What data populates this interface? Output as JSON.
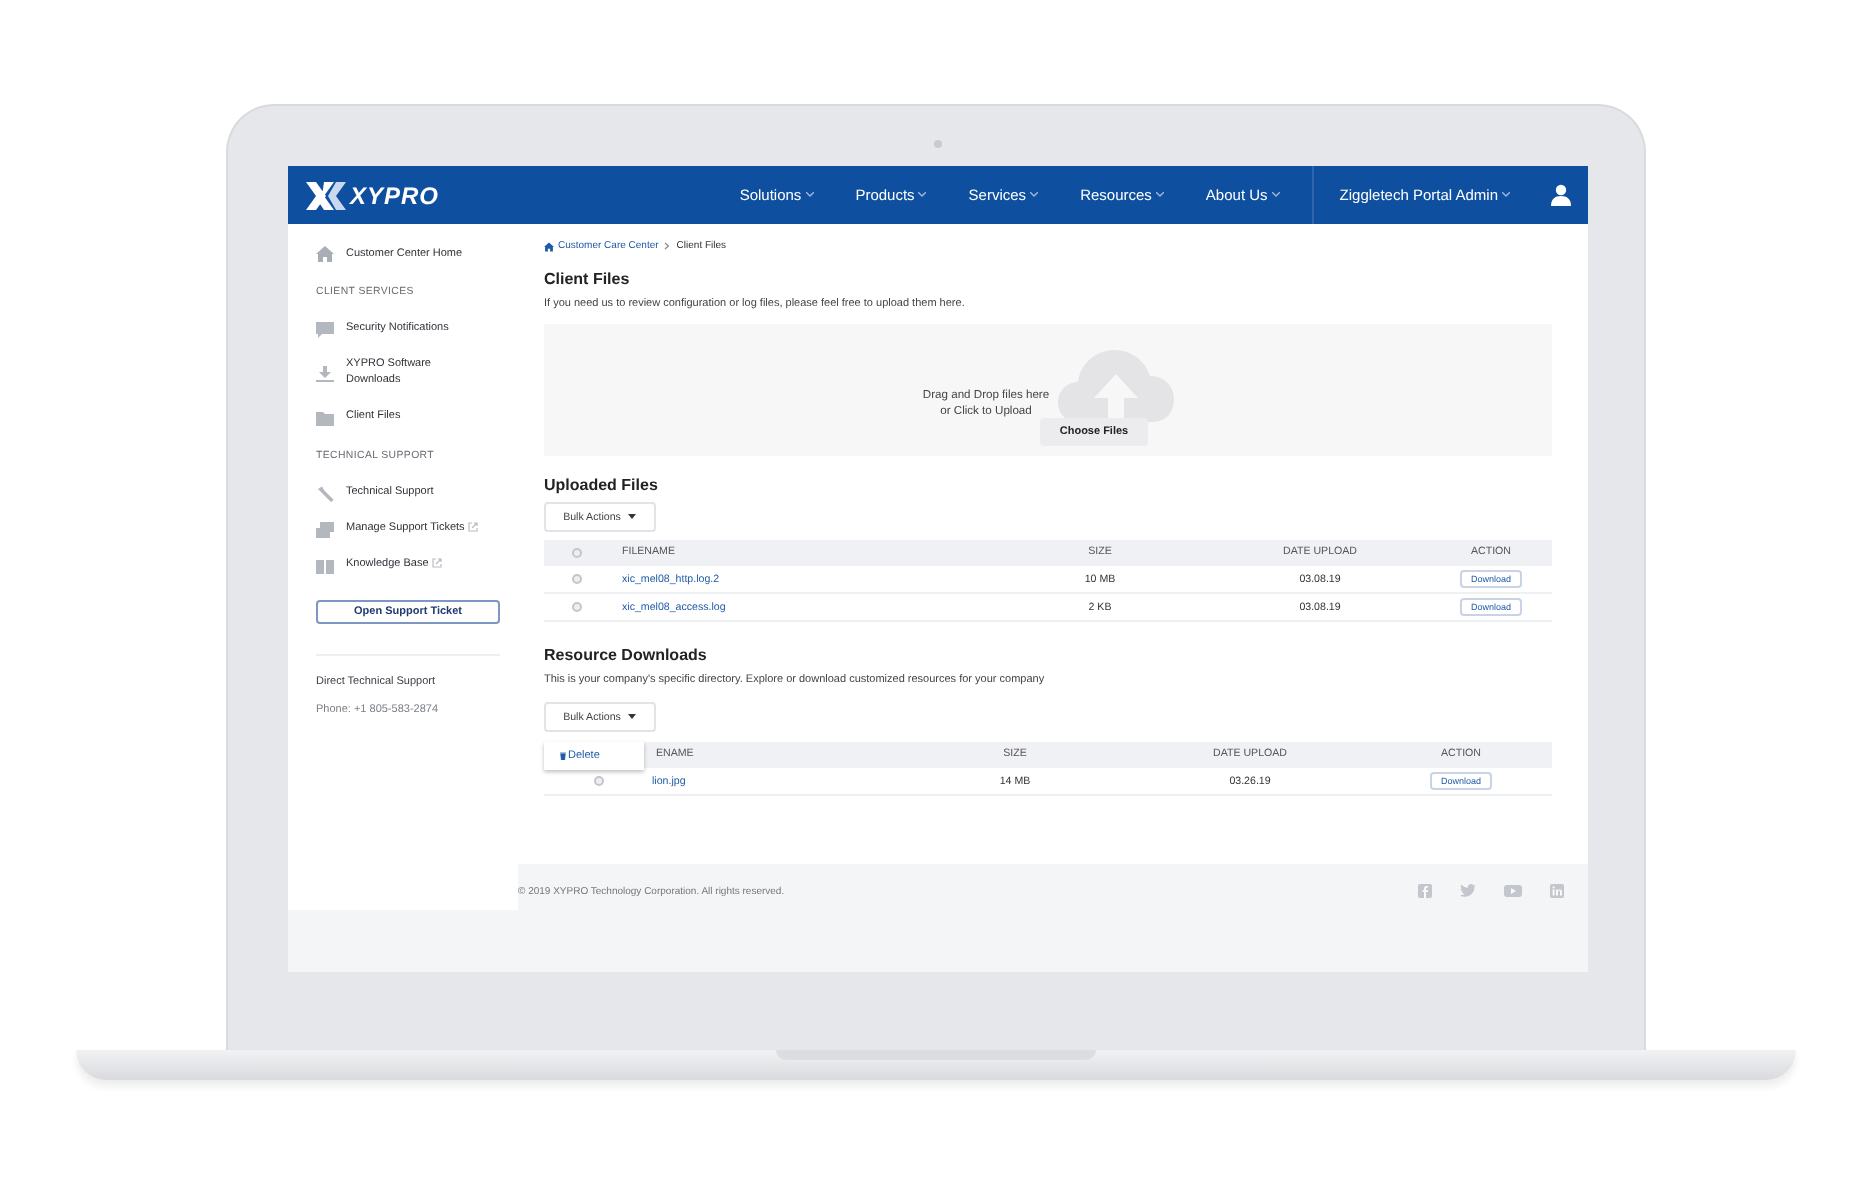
{
  "nav": {
    "logo": "XYPRO",
    "items": [
      {
        "label": "Solutions"
      },
      {
        "label": "Products"
      },
      {
        "label": "Services"
      },
      {
        "label": "Resources"
      },
      {
        "label": "About Us"
      }
    ],
    "account": "Ziggletech Portal Admin"
  },
  "sidebar": {
    "home": "Customer Center Home",
    "sections": [
      {
        "heading": "CLIENT SERVICES",
        "items": [
          {
            "label": "Security Notifications",
            "external": false
          },
          {
            "label": "XYPRO Software Downloads",
            "external": false
          },
          {
            "label": "Client Files",
            "external": false
          }
        ]
      },
      {
        "heading": "TECHNICAL SUPPORT",
        "items": [
          {
            "label": "Technical Support",
            "external": false
          },
          {
            "label": "Manage Support Tickets",
            "external": true
          },
          {
            "label": "Knowledge Base",
            "external": true
          }
        ]
      }
    ],
    "button": "Open Support Ticket",
    "contact_title": "Direct Technical Support",
    "phone": "Phone: +1 805-583-2874"
  },
  "breadcrumb": [
    "Customer Care Center",
    "Client Files"
  ],
  "client_files": {
    "title": "Client Files",
    "description": "If you need us to review configuration or log files, please feel free to upload them here.",
    "drop_lines": [
      "Drag and Drop files here",
      "or Click to Upload"
    ],
    "choose_button": "Choose Files"
  },
  "uploaded": {
    "title": "Uploaded Files",
    "bulk_button": "Bulk Actions",
    "all_checked": false,
    "columns": [
      "FILENAME",
      "SIZE",
      "DATE UPLOAD",
      "ACTION"
    ],
    "rows": [
      {
        "checked": false,
        "filename": "xic_mel08_http.log.2",
        "size": "10 MB",
        "date": "03.08.19",
        "action": "Download"
      },
      {
        "checked": false,
        "filename": "xic_mel08_access.log",
        "size": "2 KB",
        "date": "03.08.19",
        "action": "Download"
      }
    ]
  },
  "resources": {
    "title": "Resource Downloads",
    "description": "This is your company's specific directory. Explore or download customized resources for your company",
    "bulk_button": "Bulk Actions",
    "menu": {
      "open": true,
      "items": [
        {
          "label": "Delete"
        }
      ]
    },
    "columns": [
      "ENAME",
      "SIZE",
      "DATE UPLOAD",
      "ACTION"
    ],
    "rows": [
      {
        "checked": false,
        "filename": "lion.jpg",
        "size": "14 MB",
        "date": "03.26.19",
        "action": "Download"
      }
    ]
  },
  "footer": {
    "copyright": "© 2019 XYPRO Technology Corporation. All rights reserved."
  }
}
